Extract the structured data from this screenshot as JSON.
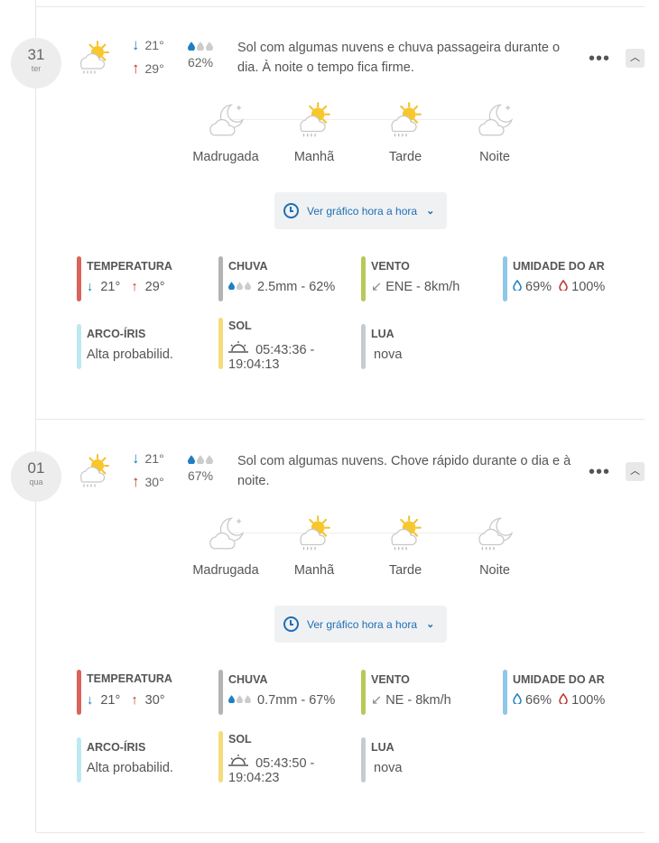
{
  "days": [
    {
      "date": "31",
      "weekday": "ter",
      "min_temp": "21°",
      "max_temp": "29°",
      "rain_prob": "62%",
      "summary": "Sol com algumas nuvens e chuva passageira durante o dia. À noite o tempo fica firme.",
      "periods": [
        {
          "label": "Madrugada",
          "icon": "moon-cloud-icon"
        },
        {
          "label": "Manhã",
          "icon": "sun-cloud-rain-icon"
        },
        {
          "label": "Tarde",
          "icon": "sun-cloud-rain-icon"
        },
        {
          "label": "Noite",
          "icon": "moon-cloud-icon"
        }
      ],
      "hourly_button": "Ver gráfico hora a hora",
      "stats": {
        "temperatura": {
          "label": "TEMPERATURA",
          "min": "21°",
          "max": "29°"
        },
        "chuva": {
          "label": "CHUVA",
          "value": "2.5mm - 62%"
        },
        "vento": {
          "label": "VENTO",
          "value": "ENE - 8km/h"
        },
        "umidade": {
          "label": "UMIDADE DO AR",
          "min": "69%",
          "max": "100%"
        },
        "arco_iris": {
          "label": "ARCO-ÍRIS",
          "value": "Alta probabilid."
        },
        "sol": {
          "label": "SOL",
          "value": "05:43:36 -",
          "value2": "19:04:13"
        },
        "lua": {
          "label": "LUA",
          "value": "nova"
        }
      }
    },
    {
      "date": "01",
      "weekday": "qua",
      "min_temp": "21°",
      "max_temp": "30°",
      "rain_prob": "67%",
      "summary": "Sol com algumas nuvens. Chove rápido durante o dia e à noite.",
      "periods": [
        {
          "label": "Madrugada",
          "icon": "moon-cloud-icon"
        },
        {
          "label": "Manhã",
          "icon": "sun-cloud-rain-icon"
        },
        {
          "label": "Tarde",
          "icon": "sun-cloud-rain-icon"
        },
        {
          "label": "Noite",
          "icon": "moon-cloud-rain-icon"
        }
      ],
      "hourly_button": "Ver gráfico hora a hora",
      "stats": {
        "temperatura": {
          "label": "TEMPERATURA",
          "min": "21°",
          "max": "30°"
        },
        "chuva": {
          "label": "CHUVA",
          "value": "0.7mm - 67%"
        },
        "vento": {
          "label": "VENTO",
          "value": "NE - 8km/h"
        },
        "umidade": {
          "label": "UMIDADE DO AR",
          "min": "66%",
          "max": "100%"
        },
        "arco_iris": {
          "label": "ARCO-ÍRIS",
          "value": "Alta probabilid."
        },
        "sol": {
          "label": "SOL",
          "value": "05:43:50 -",
          "value2": "19:04:23"
        },
        "lua": {
          "label": "LUA",
          "value": "nova"
        }
      }
    }
  ],
  "colors": {
    "temperatura": "#d9645a",
    "chuva": "#b3b3b3",
    "vento": "#b7c957",
    "umidade": "#8ec7ea",
    "arco_iris": "#bde9f1",
    "sol": "#f5dc7a",
    "lua": "#c4ccd1"
  }
}
